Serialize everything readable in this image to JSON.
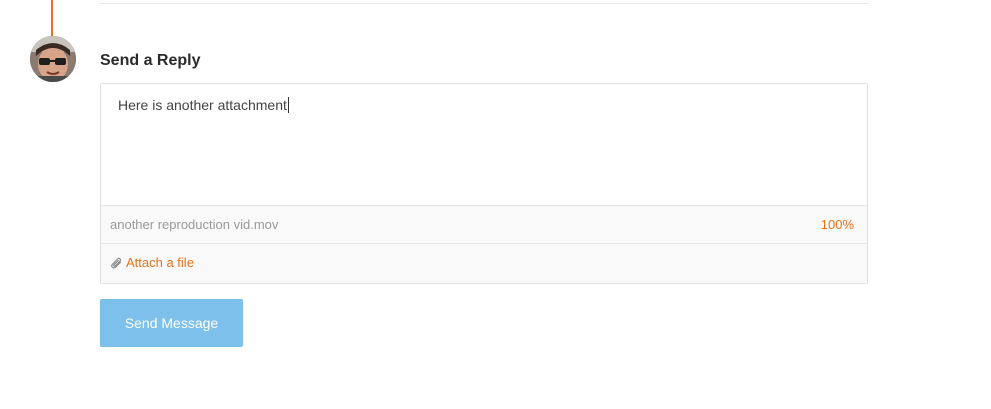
{
  "reply": {
    "heading": "Send a Reply",
    "message_text": "Here is another attachment",
    "attachment": {
      "file_name": "another reproduction vid.mov",
      "progress": "100%"
    },
    "attach_label": "Attach a file",
    "send_label": "Send Message"
  },
  "icons": {
    "attach": "paperclip-icon",
    "avatar": "user-avatar"
  },
  "colors": {
    "accent": "#e8711a",
    "send_button": "#7dc0ec",
    "heading_text": "#2b2b2b",
    "muted_text": "#9a9a9a"
  }
}
